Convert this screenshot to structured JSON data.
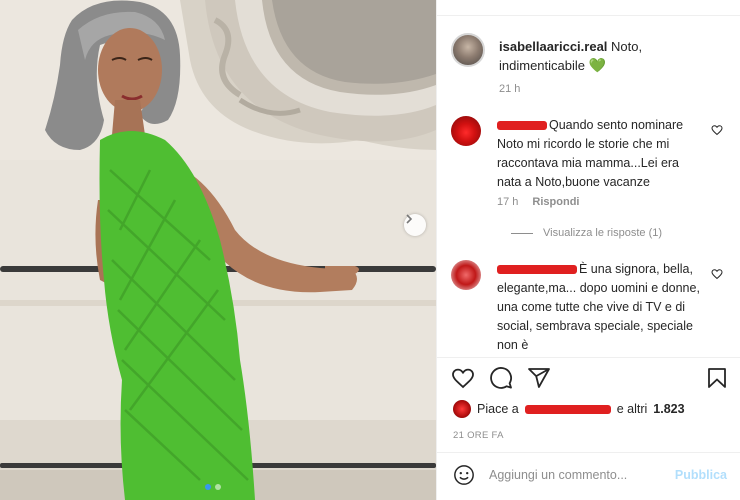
{
  "post": {
    "username": "isabellaaricci.real",
    "caption": " Noto, indimenticabile ",
    "caption_emoji": "💚",
    "time": "21 h"
  },
  "comments": [
    {
      "text": "Quando sento nominare Noto mi ricordo le storie che mi raccontava mia mamma...Lei era nata a Noto,buone vacanze",
      "time": "17 h",
      "reply_label": "Rispondi",
      "view_replies": "Visualizza le risposte (1)"
    },
    {
      "text": "È una signora, bella, elegante,ma... dopo uomini e donne, una come tutte che vive di TV e di social, sembrava speciale, speciale non è"
    }
  ],
  "likes": {
    "prefix": "Piace a",
    "suffix": "e altri",
    "count": "1.823"
  },
  "post_date": "21 ORE FA",
  "composer": {
    "placeholder": "Aggiungi un commento...",
    "publish_label": "Pubblica"
  },
  "colors": {
    "dress": "#4fbe32",
    "link_disabled": "#b2dffc",
    "redaction": "#e02020",
    "secondary_text": "#8e8e8e"
  },
  "icons": [
    "chevron-right-icon",
    "heart-icon",
    "comment-icon",
    "share-icon",
    "bookmark-icon",
    "emoji-icon"
  ]
}
